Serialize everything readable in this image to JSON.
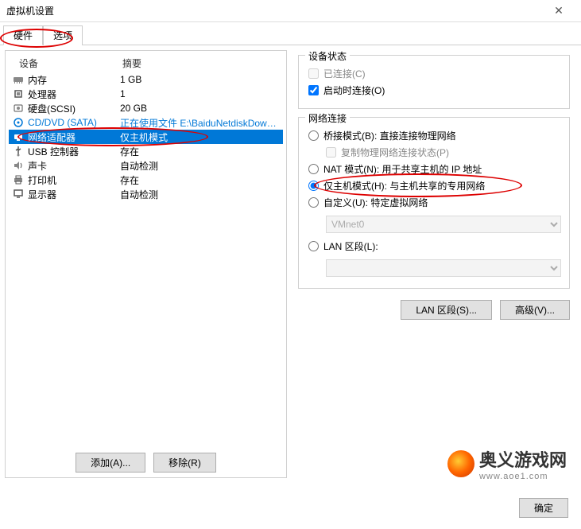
{
  "window": {
    "title": "虚拟机设置"
  },
  "tabs": {
    "hardware": "硬件",
    "options": "选项"
  },
  "listHeader": {
    "device": "设备",
    "summary": "摘要"
  },
  "devices": [
    {
      "icon": "memory",
      "name": "内存",
      "summary": "1 GB"
    },
    {
      "icon": "cpu",
      "name": "处理器",
      "summary": "1"
    },
    {
      "icon": "disk",
      "name": "硬盘(SCSI)",
      "summary": "20 GB"
    },
    {
      "icon": "cd",
      "name": "CD/DVD (SATA)",
      "summary": "正在使用文件 E:\\BaiduNetdiskDownl...",
      "special": true
    },
    {
      "icon": "nic",
      "name": "网络适配器",
      "summary": "仅主机模式",
      "selected": true
    },
    {
      "icon": "usb",
      "name": "USB 控制器",
      "summary": "存在"
    },
    {
      "icon": "sound",
      "name": "声卡",
      "summary": "自动检测"
    },
    {
      "icon": "printer",
      "name": "打印机",
      "summary": "存在"
    },
    {
      "icon": "display",
      "name": "显示器",
      "summary": "自动检测"
    }
  ],
  "buttons": {
    "add": "添加(A)...",
    "remove": "移除(R)",
    "lanSegments": "LAN 区段(S)...",
    "advanced": "高级(V)...",
    "ok": "确定"
  },
  "deviceStatus": {
    "title": "设备状态",
    "connected": "已连接(C)",
    "connectAtPowerOn": "启动时连接(O)"
  },
  "netConnection": {
    "title": "网络连接",
    "bridged": "桥接模式(B): 直接连接物理网络",
    "replicate": "复制物理网络连接状态(P)",
    "nat": "NAT 模式(N): 用于共享主机的 IP 地址",
    "hostOnly": "仅主机模式(H): 与主机共享的专用网络",
    "custom": "自定义(U): 特定虚拟网络",
    "vmnet": "VMnet0",
    "lanSegment": "LAN 区段(L):"
  },
  "watermark": {
    "text": "奥义游戏网",
    "sub": "www.aoe1.com"
  }
}
